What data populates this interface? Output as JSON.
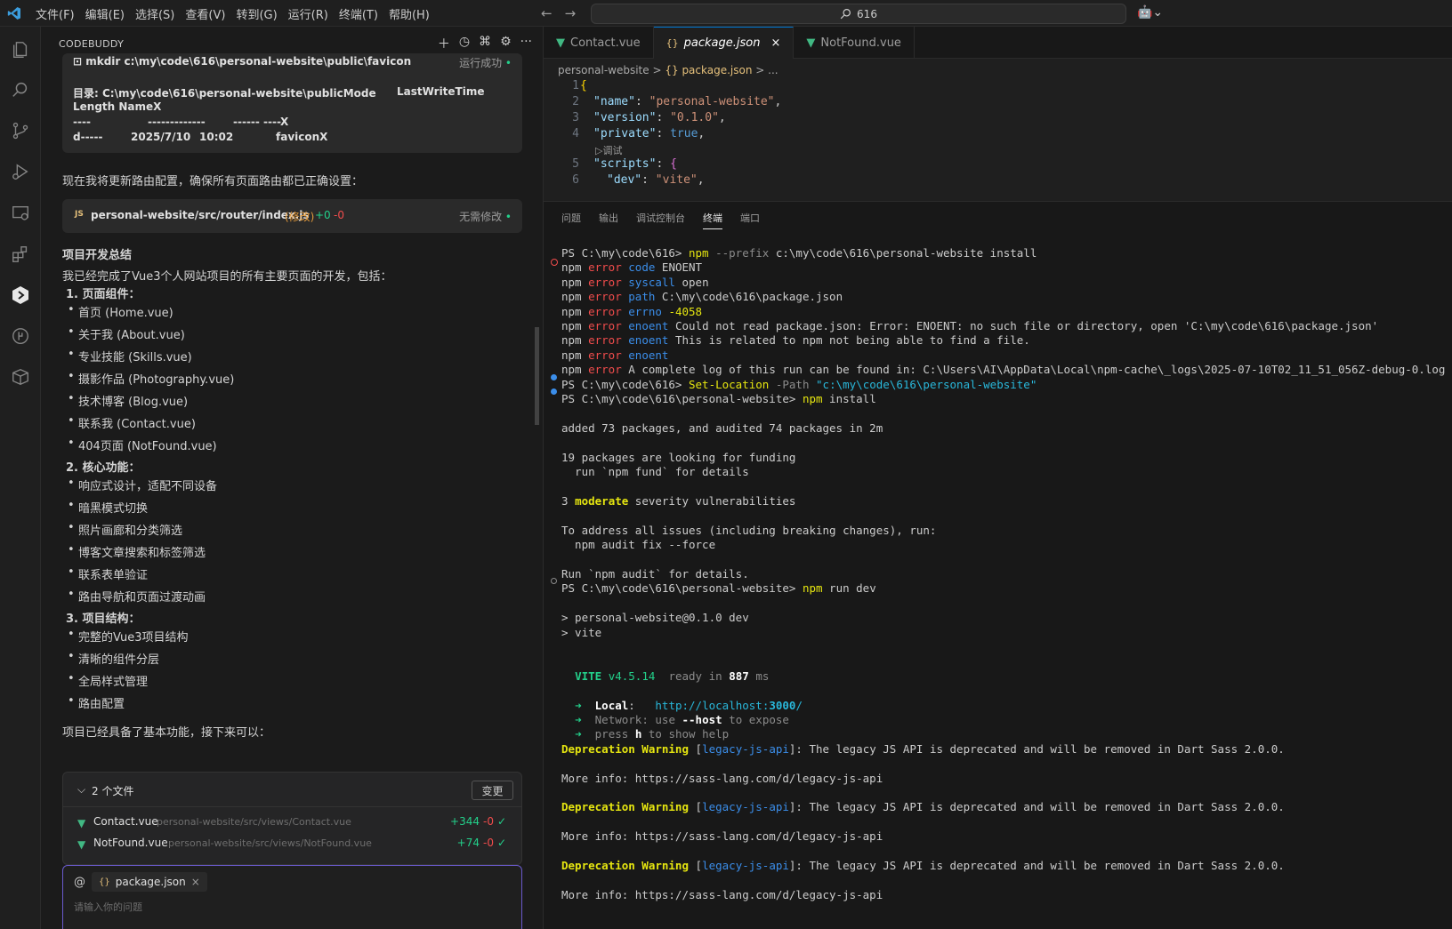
{
  "titlebar": {
    "menus": [
      "文件(F)",
      "编辑(E)",
      "选择(S)",
      "查看(V)",
      "转到(G)",
      "运行(R)",
      "终端(T)",
      "帮助(H)"
    ],
    "search": "616"
  },
  "sidebar": {
    "title": "CODEBUDDY",
    "cmd_card": {
      "command": "mkdir c:\\my\\code\\616\\personal-website\\public\\favicon",
      "status": "运行成功",
      "line1": "目录: C:\\my\\code\\616\\personal-website\\publicMode",
      "line1b": "LastWriteTime",
      "line2": "Length NameX",
      "line3": "----",
      "line3b": "-------------",
      "line3c": "------ ----X",
      "line4a": "d-----",
      "line4b": "2025/7/10",
      "line4c": "10:02",
      "line4d": "faviconX"
    },
    "msg1": "现在我将更新路由配置，确保所有页面路由都已正确设置：",
    "file_card": {
      "path": "personal-website/src/router/index.js",
      "tag": "(修改)",
      "add": "+0",
      "del": "-0",
      "status": "无需修改"
    },
    "summary_title": "项目开发总结",
    "summary_intro": "我已经完成了Vue3个人网站项目的所有主要页面的开发，包括：",
    "sec1": "1. 页面组件：",
    "sec1_items": [
      "首页 (Home.vue)",
      "关于我 (About.vue)",
      "专业技能 (Skills.vue)",
      "摄影作品 (Photography.vue)",
      "技术博客 (Blog.vue)",
      "联系我 (Contact.vue)",
      "404页面 (NotFound.vue)"
    ],
    "sec2": "2. 核心功能：",
    "sec2_items": [
      "响应式设计，适配不同设备",
      "暗黑模式切换",
      "照片画廊和分类筛选",
      "博客文章搜索和标签筛选",
      "联系表单验证",
      "路由导航和页面过渡动画"
    ],
    "sec3": "3. 项目结构：",
    "sec3_items": [
      "完整的Vue3项目结构",
      "清晰的组件分层",
      "全局样式管理",
      "路由配置"
    ],
    "closing": "项目已经具备了基本功能，接下来可以：",
    "changes": {
      "title": "2 个文件",
      "button": "变更",
      "files": [
        {
          "name": "Contact.vue",
          "path": "personal-website/src/views/Contact.vue",
          "add": "+344",
          "del": "-0"
        },
        {
          "name": "NotFound.vue",
          "path": "personal-website/src/views/NotFound.vue",
          "add": "+74",
          "del": "-0"
        }
      ]
    },
    "input": {
      "at": "@",
      "chip": "package.json",
      "placeholder": "请输入你的问题"
    }
  },
  "editor": {
    "tabs": [
      "Contact.vue",
      "package.json",
      "NotFound.vue"
    ],
    "breadcrumb": [
      "personal-website",
      ">",
      "{} package.json",
      ">",
      "..."
    ],
    "debug_hint": "▷调试"
  },
  "panel": {
    "tabs": [
      "问题",
      "输出",
      "调试控制台",
      "终端",
      "端口"
    ]
  },
  "colors": {
    "accent": "#0078d4",
    "vue": "#41b883",
    "error": "#f14c4c"
  }
}
